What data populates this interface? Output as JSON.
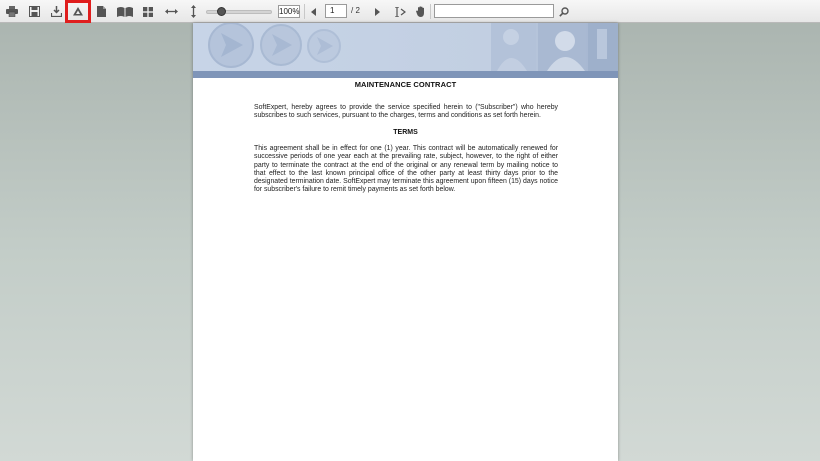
{
  "toolbar": {
    "buttons": [
      {
        "icon": "print-icon"
      },
      {
        "icon": "save-icon"
      },
      {
        "icon": "download-icon"
      },
      {
        "icon": "google-drive-icon",
        "highlighted": true
      },
      {
        "icon": "single-page-icon"
      },
      {
        "icon": "two-page-icon"
      },
      {
        "icon": "grid-view-icon"
      },
      {
        "icon": "fit-width-icon"
      },
      {
        "icon": "fit-height-icon"
      }
    ],
    "zoom": {
      "value_text": "100%",
      "slider_level": 0.2
    },
    "pagination": {
      "current": "1",
      "total_text": "/ 2"
    },
    "search": {
      "value": ""
    },
    "highlight_color": "#e01e1e"
  },
  "document": {
    "title": "MAINTENANCE CONTRACT",
    "intro": "SoftExpert, hereby agrees to provide the service specified herein to (\"Subscriber\") who hereby subscribes to such services, pursuant to the charges, terms and conditions as set forth herein.",
    "section_heading": "TERMS",
    "terms_paragraph": "This agreement shall be in effect for one (1) year. This contract will be automatically renewed for successive periods of one year each at the prevailing rate, subject, however, to the right of either party to terminate the contract at the end of the original or any renewal term by mailing notice to that effect to the last known principal office of the other party at least thirty days prior to the designated termination date. SoftExpert may terminate this agreement upon fifteen (15) days notice for subscriber's failure to remit timely payments as set forth below."
  }
}
